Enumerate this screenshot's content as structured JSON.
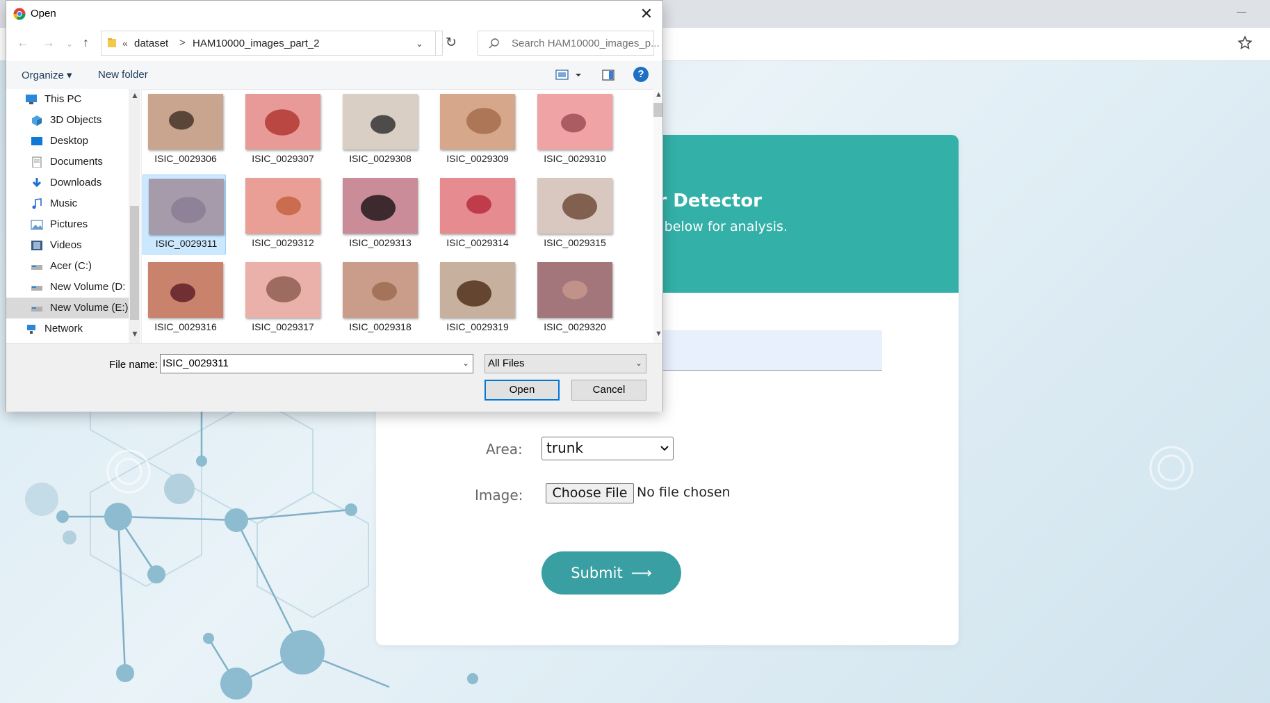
{
  "dialog": {
    "title": "Open",
    "close_glyph": "✕",
    "nav": {
      "back_glyph": "←",
      "forward_glyph": "→",
      "recent_glyph": "⌄",
      "up_glyph": "↑",
      "refresh_glyph": "↻"
    },
    "path": {
      "overflow_glyph": "«",
      "separator": ">",
      "items": [
        "dataset",
        "HAM10000_images_part_2"
      ],
      "dropdown_glyph": "⌄"
    },
    "search": {
      "placeholder": "Search HAM10000_images_p..."
    },
    "toolbar": {
      "organize": "Organize ▾",
      "new_folder": "New folder",
      "help": "?"
    },
    "nav_pane": {
      "items": [
        {
          "label": "This PC",
          "icon": "computer-icon"
        },
        {
          "label": "3D Objects",
          "icon": "cube-icon"
        },
        {
          "label": "Desktop",
          "icon": "desktop-icon"
        },
        {
          "label": "Documents",
          "icon": "document-icon"
        },
        {
          "label": "Downloads",
          "icon": "download-icon"
        },
        {
          "label": "Music",
          "icon": "music-icon"
        },
        {
          "label": "Pictures",
          "icon": "pictures-icon"
        },
        {
          "label": "Videos",
          "icon": "video-icon"
        },
        {
          "label": "Acer (C:)",
          "icon": "drive-icon"
        },
        {
          "label": "New Volume (D:",
          "icon": "drive-icon"
        },
        {
          "label": "New Volume (E:)",
          "icon": "drive-icon"
        },
        {
          "label": "Network",
          "icon": "network-icon"
        }
      ],
      "selected": "New Volume (E:)"
    },
    "files": [
      {
        "name": "ISIC_0029306",
        "bg": "#c9a48f",
        "spot": "#3e2e22"
      },
      {
        "name": "ISIC_0029307",
        "bg": "#e79a98",
        "spot": "#b0322e"
      },
      {
        "name": "ISIC_0029308",
        "bg": "#d9cfc5",
        "spot": "#2a2a2a"
      },
      {
        "name": "ISIC_0029309",
        "bg": "#d7a78c",
        "spot": "#a26a48"
      },
      {
        "name": "ISIC_0029310",
        "bg": "#f0a3a5",
        "spot": "#9a4a52"
      },
      {
        "name": "ISIC_0029311",
        "bg": "#a59bab",
        "spot": "#8a7a92"
      },
      {
        "name": "ISIC_0029312",
        "bg": "#e99f95",
        "spot": "#c2603c"
      },
      {
        "name": "ISIC_0029313",
        "bg": "#c98c98",
        "spot": "#1a1214"
      },
      {
        "name": "ISIC_0029314",
        "bg": "#e68c90",
        "spot": "#b5283a"
      },
      {
        "name": "ISIC_0029315",
        "bg": "#d9c8c0",
        "spot": "#6a4632"
      },
      {
        "name": "ISIC_0029316",
        "bg": "#c9826c",
        "spot": "#5a1a24"
      },
      {
        "name": "ISIC_0029317",
        "bg": "#eab0aa",
        "spot": "#8a5a4c"
      },
      {
        "name": "ISIC_0029318",
        "bg": "#c99d8a",
        "spot": "#9a6a4e"
      },
      {
        "name": "ISIC_0029319",
        "bg": "#c7b09e",
        "spot": "#4a2a14"
      },
      {
        "name": "ISIC_0029320",
        "bg": "#a2767a",
        "spot": "#c89a8e"
      }
    ],
    "selected_file": "ISIC_0029311",
    "filename_label": "File name:",
    "filename_value": "ISIC_0029311",
    "filetype_value": "All Files",
    "open_label": "Open",
    "cancel_label": "Cancel"
  },
  "page": {
    "title_fragment": "er Detector",
    "subtitle_fragment": "n below for analysis.",
    "area_label": "Area:",
    "area_value": "trunk",
    "image_label": "Image:",
    "choose_file_label": "Choose File",
    "no_file_text": "No file chosen",
    "submit_label": "Submit",
    "submit_arrow": "⟶",
    "header_color": "#33b0a8",
    "submit_color": "#3a9fa3"
  }
}
